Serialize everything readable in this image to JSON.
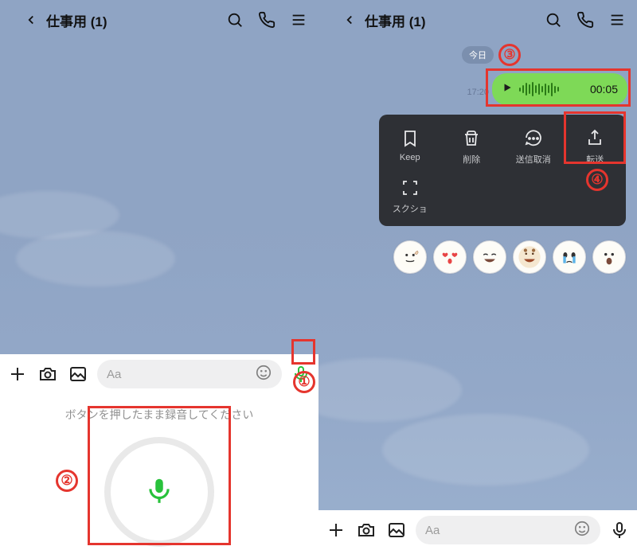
{
  "left": {
    "header": {
      "title": "仕事用 (1)"
    },
    "input": {
      "placeholder": "Aa"
    },
    "record_hint": "ボタンを押したまま録音してください",
    "annot1": "①",
    "annot2": "②"
  },
  "right": {
    "header": {
      "title": "仕事用 (1)"
    },
    "date_badge": "今日",
    "timestamp": "17:20",
    "voice_duration": "00:05",
    "context_menu": {
      "keep": "Keep",
      "delete": "削除",
      "unsend": "送信取消",
      "forward": "転送",
      "screenshot": "スクショ"
    },
    "reactions": [
      "thumbs-up",
      "heart-eyes",
      "laugh",
      "grin",
      "crying",
      "open-mouth"
    ],
    "input": {
      "placeholder": "Aa"
    },
    "annot3": "③",
    "annot4": "④"
  }
}
